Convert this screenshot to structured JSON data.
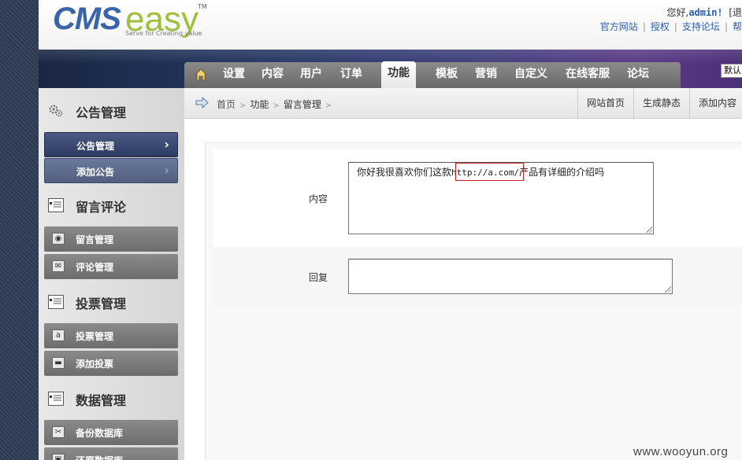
{
  "header": {
    "logo_text_main": "CMS",
    "logo_text_accent": "easy",
    "logo_tm": "TM",
    "logo_slogan": "Serve for Creating value",
    "greeting_prefix": "您好,",
    "username": "admin!",
    "greeting_suffix": "[退",
    "links": [
      "官方网站",
      "授权",
      "支持论坛",
      "帮"
    ]
  },
  "nav": {
    "items": [
      "设置",
      "内容",
      "用户",
      "订单",
      "功能",
      "模板",
      "营销",
      "自定义",
      "在线客服",
      "论坛"
    ],
    "active": "功能",
    "language_select": "默认"
  },
  "sidebar": {
    "sections": [
      {
        "title": "公告管理",
        "items": [
          "公告管理",
          "添加公告"
        ]
      },
      {
        "title": "留言评论",
        "items": [
          "留言管理",
          "评论管理"
        ]
      },
      {
        "title": "投票管理",
        "items": [
          "投票管理",
          "添加投票"
        ]
      },
      {
        "title": "数据管理",
        "items": [
          "备份数据库",
          "还原数据库"
        ]
      }
    ]
  },
  "breadcrumb": {
    "items": [
      "首页",
      "功能",
      "留言管理"
    ],
    "separator": ">",
    "actions": [
      "网站首页",
      "生成静态",
      "添加内容"
    ]
  },
  "form": {
    "content_label": "内容",
    "content_prefix": "你好我很喜欢你们这款",
    "content_url": "http://a.com/",
    "content_suffix": "产品有详细的介绍吗",
    "reply_label": "回复",
    "reply_value": ""
  },
  "watermark": "www.wooyun.org",
  "colors": {
    "nav_gradient_start": "#1a2744",
    "nav_gradient_end": "#5a3b86",
    "sidebar_active": "#2e3b62",
    "highlight_box": "#cc2222",
    "link_blue": "#2b5fb0"
  }
}
